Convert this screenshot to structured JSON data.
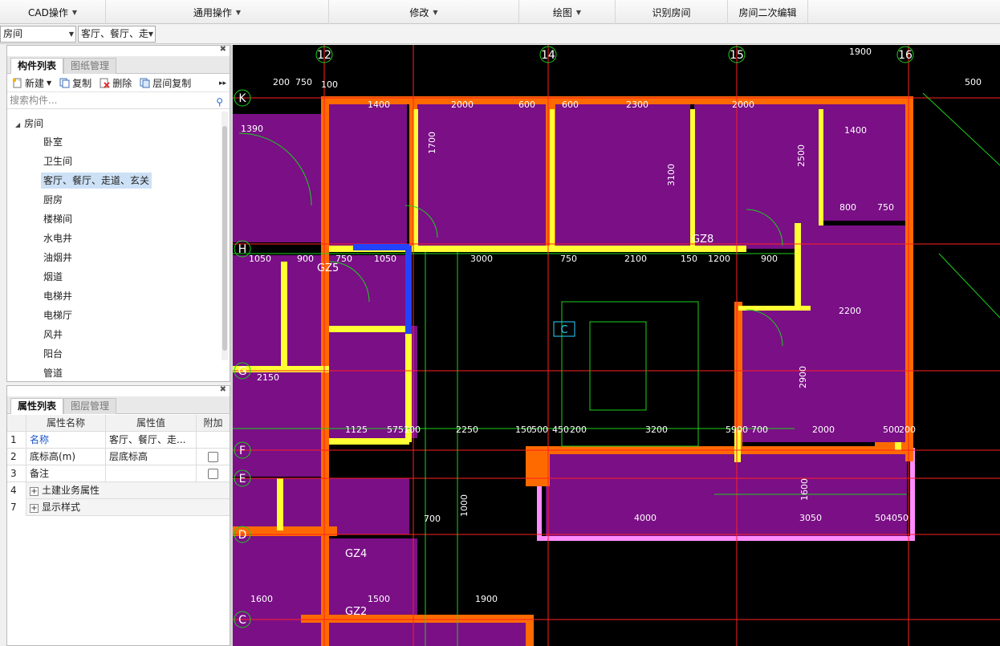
{
  "ribbon": {
    "groups": [
      {
        "label": "CAD操作",
        "caret": true
      },
      {
        "label": "通用操作",
        "caret": true
      },
      {
        "label": "修改",
        "caret": true
      },
      {
        "label": "绘图",
        "caret": true
      },
      {
        "label": "识别房间",
        "caret": false
      },
      {
        "label": "房间二次编辑",
        "caret": false
      }
    ]
  },
  "combos": {
    "category": "房间",
    "element": "客厅、餐厅、走"
  },
  "component_panel": {
    "tabs": [
      "构件列表",
      "图纸管理"
    ],
    "active_tab": 0,
    "toolbar": {
      "new": "新建",
      "copy": "复制",
      "delete": "删除",
      "layer_copy": "层间复制"
    },
    "search_placeholder": "搜索构件...",
    "tree_root": "房间",
    "items": [
      "卧室",
      "卫生间",
      "客厅、餐厅、走道、玄关",
      "厨房",
      "楼梯间",
      "水电井",
      "油烟井",
      "烟道",
      "电梯井",
      "电梯厅",
      "风井",
      "阳台",
      "管道"
    ],
    "selected_index": 2
  },
  "property_panel": {
    "tabs": [
      "属性列表",
      "图层管理"
    ],
    "active_tab": 0,
    "headers": {
      "name": "属性名称",
      "value": "属性值",
      "extra": "附加"
    },
    "rows": [
      {
        "num": "1",
        "name": "名称",
        "value": "客厅、餐厅、走...",
        "checkbox": false,
        "expander": false,
        "link": true
      },
      {
        "num": "2",
        "name": "底标高(m)",
        "value": "层底标高",
        "checkbox": true,
        "expander": false,
        "link": false
      },
      {
        "num": "3",
        "name": "备注",
        "value": "",
        "checkbox": true,
        "expander": false,
        "link": false
      },
      {
        "num": "4",
        "name": "土建业务属性",
        "value": "",
        "checkbox": false,
        "expander": true,
        "link": false
      },
      {
        "num": "7",
        "name": "显示样式",
        "value": "",
        "checkbox": false,
        "expander": true,
        "link": false
      }
    ]
  },
  "drawing": {
    "axis_top": [
      "12",
      "14",
      "15",
      "16"
    ],
    "axis_left": [
      "K",
      "H",
      "G",
      "F",
      "E",
      "D",
      "C"
    ],
    "room_marker": "C",
    "column_tags": [
      "GZ5",
      "GZ8",
      "GZ4",
      "GZ2"
    ],
    "dims_row1": [
      "200",
      "750",
      "100",
      "1400",
      "2000",
      "600",
      "600",
      "2300",
      "2000",
      "1900",
      "500"
    ],
    "dims_row2": [
      "1050",
      "900",
      "750",
      "1050",
      "3000",
      "750",
      "2100",
      "150",
      "1200",
      "900"
    ],
    "dims_row3": [
      "1125",
      "575",
      "100",
      "2250",
      "150",
      "500",
      "450",
      "200",
      "3200",
      "5900",
      "700",
      "2000",
      "500",
      "200"
    ],
    "dims_row4": [
      "4000",
      "3050",
      "504050"
    ],
    "dims_misc": [
      "1390",
      "1400",
      "800",
      "750",
      "2200",
      "1600",
      "1500",
      "1900",
      "700",
      "2150",
      "1700",
      "3100",
      "2500",
      "2900",
      "1600",
      "1000"
    ],
    "colors": {
      "room": "#7a0f86",
      "wall": "#ff6a00",
      "wall_inner": "#ffff33",
      "grid": "#ff2020",
      "green": "#1bd11b",
      "cyan": "#2ad4ff",
      "pink": "#ff8cff"
    }
  }
}
